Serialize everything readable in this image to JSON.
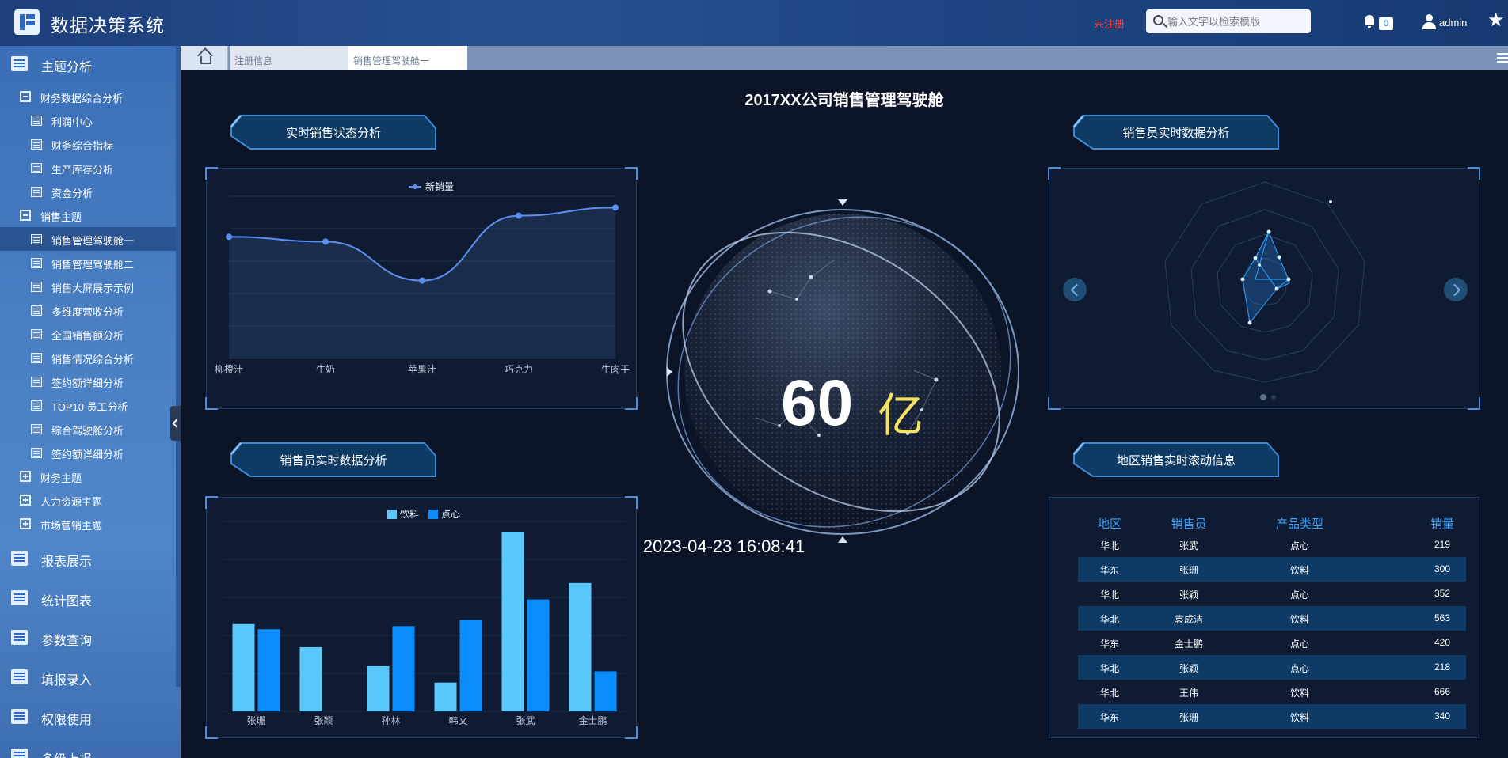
{
  "header": {
    "app_title": "数据决策系统",
    "unregistered": "未注册",
    "search_placeholder": "输入文字以检索模版",
    "notification_count": "0",
    "user_name": "admin"
  },
  "sidebar": {
    "sections": [
      {
        "label": "主题分析"
      },
      {
        "label": "报表展示"
      },
      {
        "label": "统计图表"
      },
      {
        "label": "参数查询"
      },
      {
        "label": "填报录入"
      },
      {
        "label": "权限使用"
      },
      {
        "label": "多级上报"
      }
    ],
    "groups": [
      {
        "label": "财务数据综合分析"
      },
      {
        "label": "销售主题"
      },
      {
        "label": "财务主题"
      },
      {
        "label": "人力资源主题"
      },
      {
        "label": "市场营销主题"
      }
    ],
    "items": [
      {
        "label": "利润中心"
      },
      {
        "label": "财务综合指标"
      },
      {
        "label": "生产库存分析"
      },
      {
        "label": "资金分析"
      },
      {
        "label": "销售管理驾驶舱一"
      },
      {
        "label": "销售管理驾驶舱二"
      },
      {
        "label": "销售大屏展示示例"
      },
      {
        "label": "多维度营收分析"
      },
      {
        "label": "全国销售额分析"
      },
      {
        "label": "销售情况综合分析"
      },
      {
        "label": "签约额详细分析"
      },
      {
        "label": "TOP10 员工分析"
      },
      {
        "label": "综合驾驶舱分析"
      },
      {
        "label": "签约额详细分析"
      }
    ]
  },
  "tabs": [
    {
      "label": "注册信息"
    },
    {
      "label": "销售管理驾驶舱一"
    }
  ],
  "dashboard": {
    "title": "2017XX公司销售管理驾驶舱",
    "panel_titles": {
      "realtime_sales": "实时销售状态分析",
      "salesperson_radar": "销售员实时数据分析",
      "salesperson_bar": "销售员实时数据分析",
      "region_scroll": "地区销售实时滚动信息"
    },
    "big_number": "60",
    "big_unit": "亿",
    "datetime": "2023-04-23 16:08:41",
    "colors": {
      "accent": "#4a8ede",
      "line": "#5b8ff0",
      "bar1": "#5ac8fa",
      "bar2": "#0a8cff",
      "unit": "#f2e366"
    }
  },
  "chart_data": [
    {
      "type": "line",
      "legend": [
        "新销量"
      ],
      "categories": [
        "柳橙汁",
        "牛奶",
        "苹果汁",
        "巧克力",
        "牛肉干"
      ],
      "series": [
        {
          "name": "新销量",
          "values": [
            75,
            72,
            48,
            88,
            93
          ]
        }
      ],
      "ylim": [
        0,
        100
      ]
    },
    {
      "type": "bar",
      "legend": [
        "饮料",
        "点心"
      ],
      "categories": [
        "张珊",
        "张颖",
        "孙林",
        "韩文",
        "张武",
        "金士鹏"
      ],
      "series": [
        {
          "name": "饮料",
          "values": [
            170,
            125,
            88,
            56,
            350,
            250
          ]
        },
        {
          "name": "点心",
          "values": [
            160,
            0,
            166,
            178,
            218,
            78
          ]
        }
      ],
      "ylim": [
        0,
        370
      ]
    }
  ],
  "region_table": {
    "headers": [
      "地区",
      "销售员",
      "产品类型",
      "销量"
    ],
    "rows": [
      [
        "华北",
        "张武",
        "点心",
        "219"
      ],
      [
        "华东",
        "张珊",
        "饮料",
        "300"
      ],
      [
        "华北",
        "张颖",
        "点心",
        "352"
      ],
      [
        "华北",
        "袁成洁",
        "饮料",
        "563"
      ],
      [
        "华东",
        "金士鹏",
        "点心",
        "420"
      ],
      [
        "华北",
        "张颖",
        "点心",
        "218"
      ],
      [
        "华北",
        "王伟",
        "饮料",
        "666"
      ],
      [
        "华东",
        "张珊",
        "饮料",
        "340"
      ]
    ]
  }
}
